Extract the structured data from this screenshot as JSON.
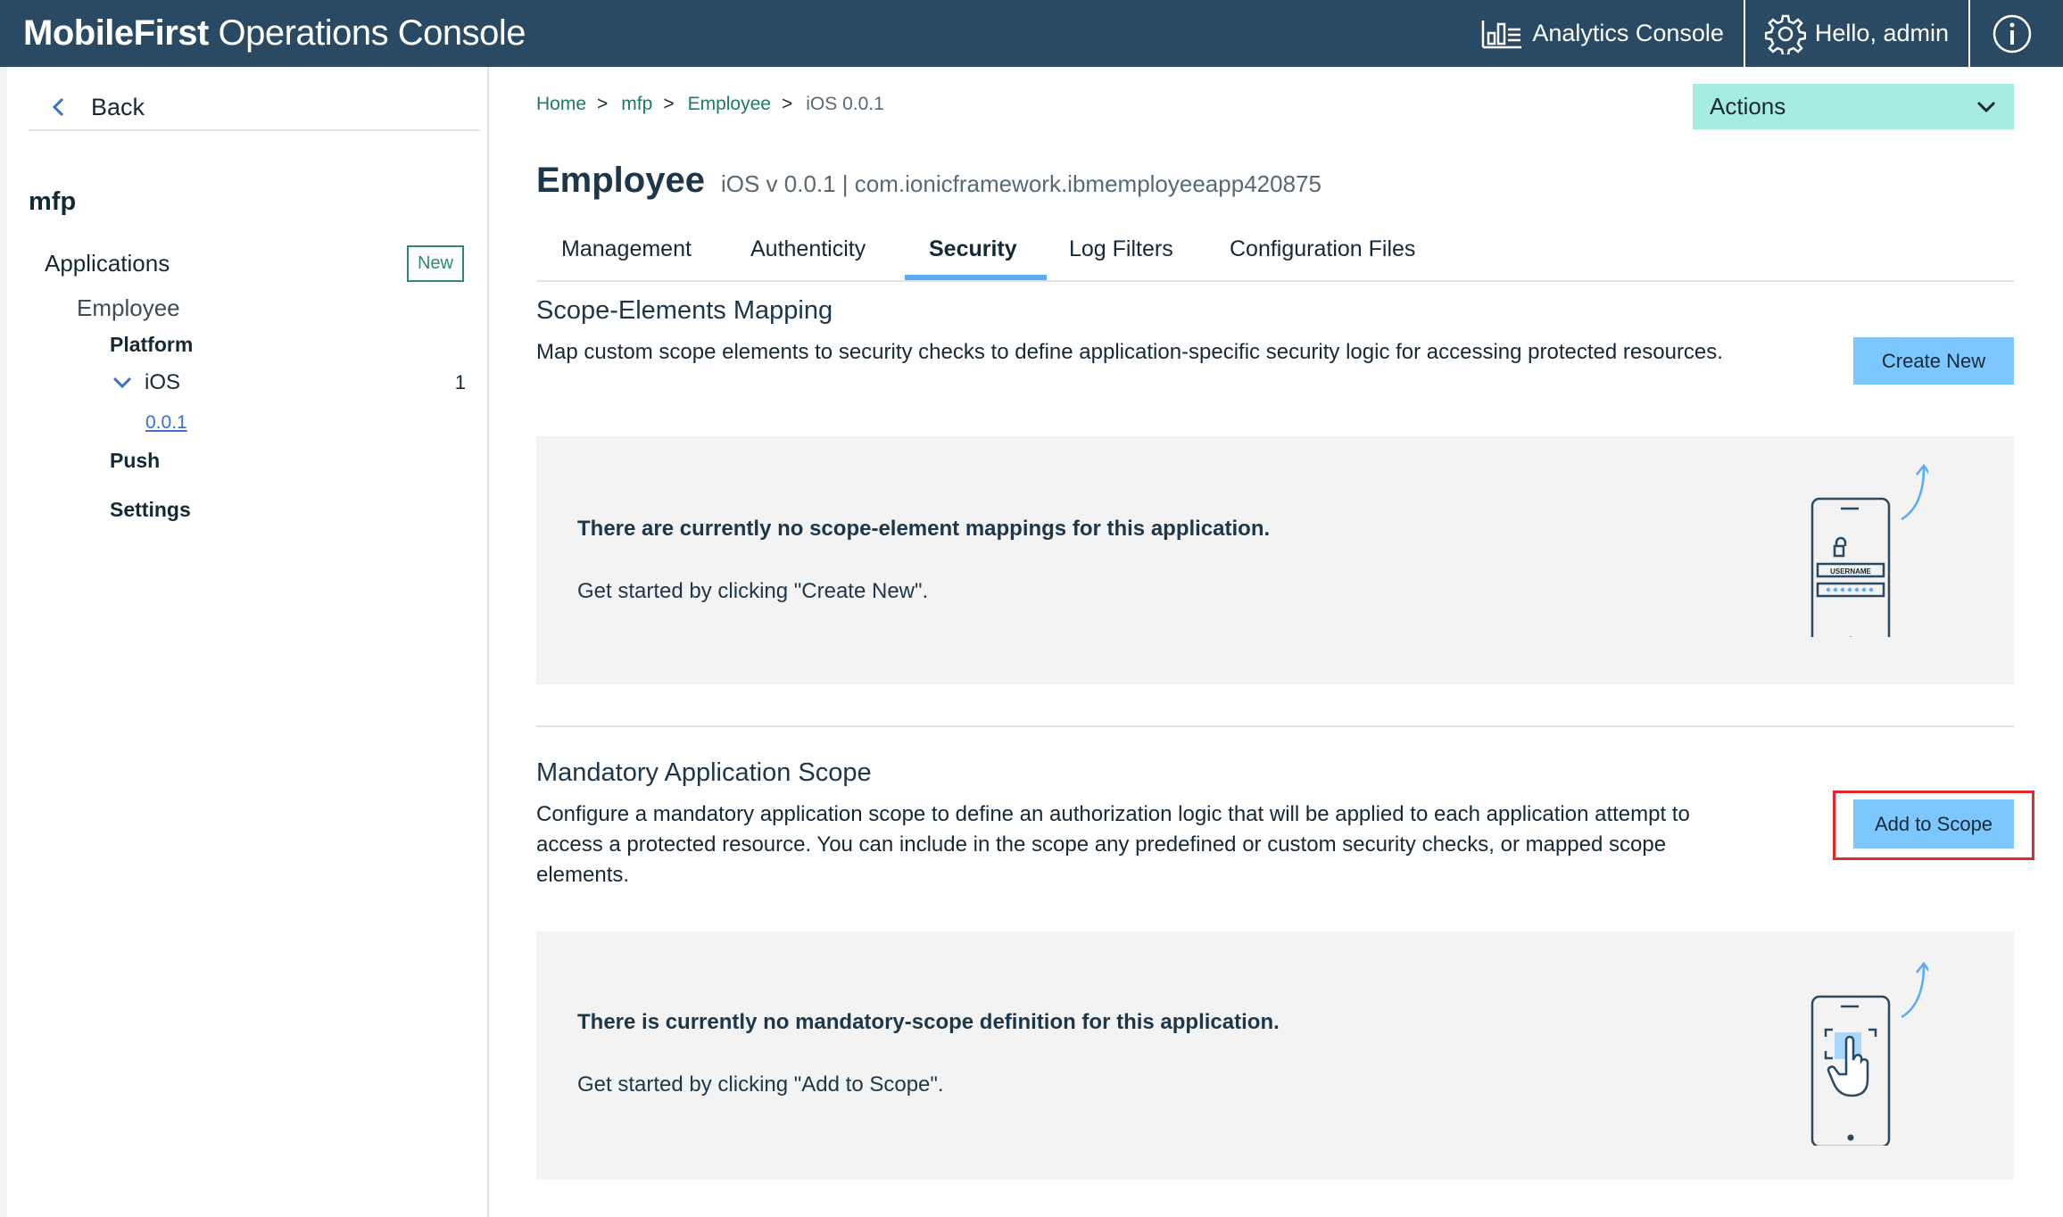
{
  "header": {
    "brand_bold": "MobileFirst",
    "brand_rest": " Operations Console",
    "analytics_label": "Analytics Console",
    "user_label": "Hello, admin"
  },
  "sidebar": {
    "back_label": "Back",
    "title": "mfp",
    "applications_label": "Applications",
    "new_badge": "New",
    "employee_label": "Employee",
    "platform_label": "Platform",
    "ios_label": "iOS",
    "ios_count": "1",
    "version_link": "0.0.1",
    "push_label": "Push",
    "settings_label": "Settings"
  },
  "breadcrumb": {
    "items": [
      "Home",
      "mfp",
      "Employee"
    ],
    "separator": ">",
    "current": "iOS 0.0.1"
  },
  "actions_label": "Actions",
  "app": {
    "name": "Employee",
    "subtitle": "iOS v 0.0.1 | com.ionicframework.ibmemployeeapp420875"
  },
  "tabs": [
    {
      "label": "Management"
    },
    {
      "label": "Authenticity"
    },
    {
      "label": "Security",
      "active": true
    },
    {
      "label": "Log Filters"
    },
    {
      "label": "Configuration Files"
    }
  ],
  "scope_mapping": {
    "title": "Scope-Elements Mapping",
    "description": "Map custom scope elements to security checks to define application-specific security logic for accessing protected resources.",
    "button_label": "Create New",
    "empty_message": "There are currently no scope-element mappings for this application.",
    "empty_hint": "Get started by clicking \"Create New\".",
    "illustration_text": "USERNAME"
  },
  "mandatory_scope": {
    "title": "Mandatory Application Scope",
    "description": "Configure a mandatory application scope to define an authorization logic that will be applied to each application attempt to access a protected resource. You can include in the scope any predefined or custom security checks, or mapped scope elements.",
    "button_label": "Add to Scope",
    "empty_message": "There is currently no mandatory-scope definition for this application.",
    "empty_hint": "Get started by clicking \"Add to Scope\"."
  },
  "colors": {
    "header_bg": "#2a4a63",
    "accent_blue": "#7cc7ff",
    "actions_bg": "#a6ece0",
    "link_green": "#1f7a60",
    "highlight_red": "#e0282e"
  }
}
